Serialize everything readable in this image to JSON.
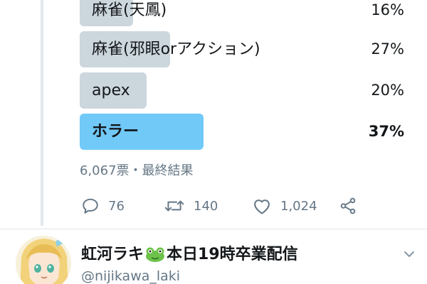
{
  "poll": {
    "options": [
      {
        "label": "麻雀(天鳳)",
        "percent": "16%",
        "share": 0.16,
        "winner": false
      },
      {
        "label": "麻雀(邪眼orアクション)",
        "percent": "27%",
        "share": 0.27,
        "winner": false
      },
      {
        "label": "apex",
        "percent": "20%",
        "share": 0.2,
        "winner": false
      },
      {
        "label": "ホラー",
        "percent": "37%",
        "share": 0.37,
        "winner": true
      }
    ],
    "meta": "6,067票・最終結果"
  },
  "actions": {
    "reply_count": "76",
    "retweet_count": "140",
    "like_count": "1,024",
    "reply_icon": "reply-icon",
    "retweet_icon": "retweet-icon",
    "like_icon": "heart-icon",
    "share_icon": "share-icon"
  },
  "next_tweet": {
    "name_part1": "虹河ラキ",
    "name_emoji": "frog-emoji",
    "name_part2": "本日19時卒業配信",
    "handle": "@nijikawa_laki",
    "menu_icon": "chevron-down-icon"
  },
  "colors": {
    "winner_bar": "#71c9f8",
    "bar": "#ccd6dd",
    "muted_text": "#657786"
  }
}
